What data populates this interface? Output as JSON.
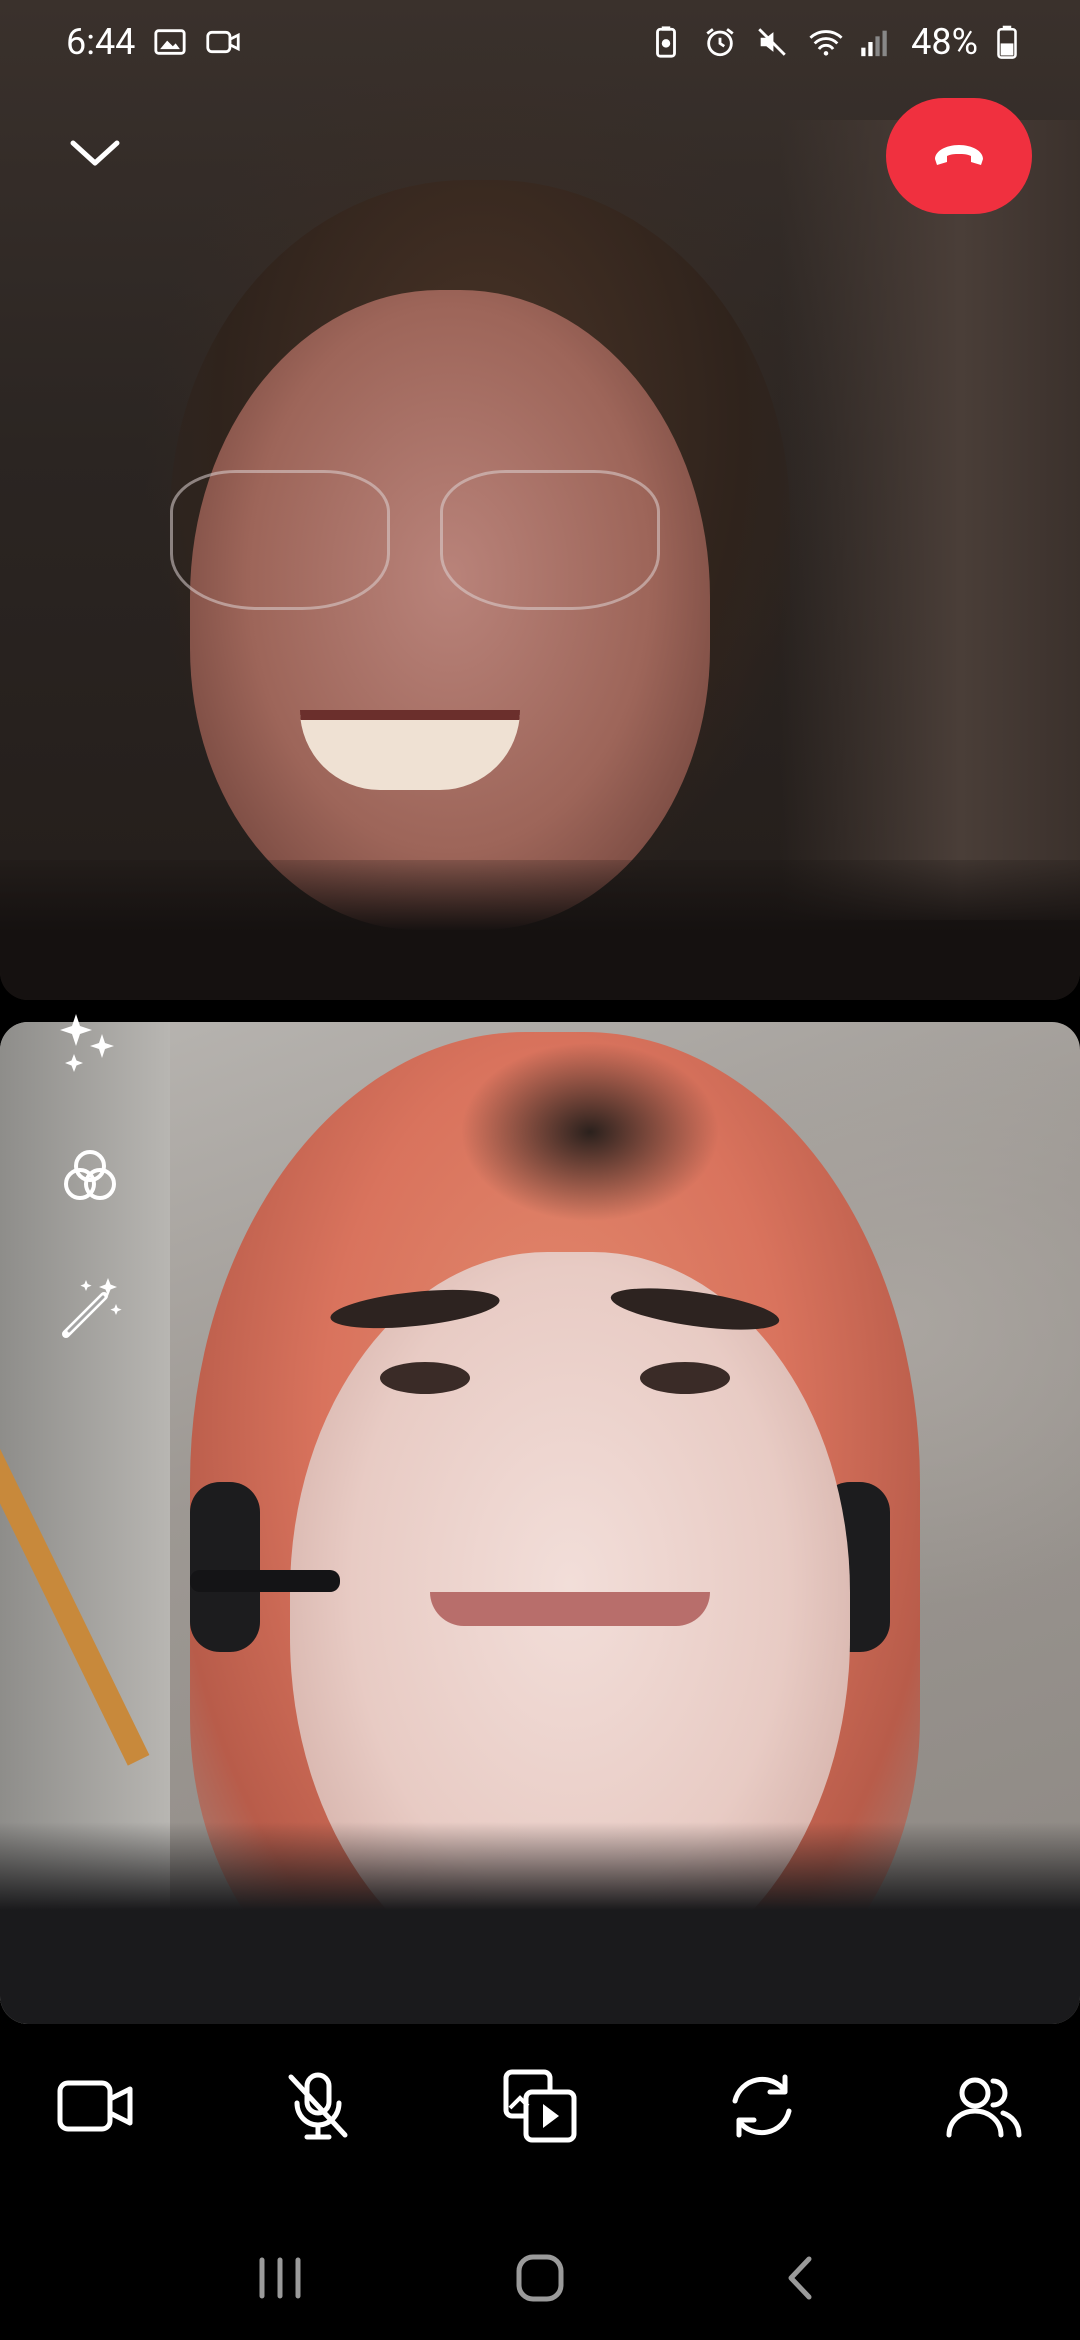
{
  "status_bar": {
    "time": "6:44",
    "battery_percent": "48%",
    "icons": [
      "gallery-icon",
      "video-notification-icon",
      "battery-saver-icon",
      "alarm-icon",
      "mute-icon",
      "wifi-icon",
      "signal-icon",
      "battery-icon"
    ]
  },
  "call": {
    "collapse_icon": "chevron-down-icon",
    "end_call_icon": "phone-hangup-icon",
    "end_call_color": "#f0303f"
  },
  "effects_menu": {
    "items": [
      "sparkles-effects-icon",
      "filters-icon",
      "magic-wand-icon"
    ]
  },
  "toolbar": {
    "buttons": [
      "camera-toggle-icon",
      "microphone-muted-icon",
      "share-media-icon",
      "switch-camera-icon",
      "participants-icon"
    ]
  },
  "system_nav": {
    "buttons": [
      "recent-apps-icon",
      "home-icon",
      "back-icon"
    ]
  }
}
